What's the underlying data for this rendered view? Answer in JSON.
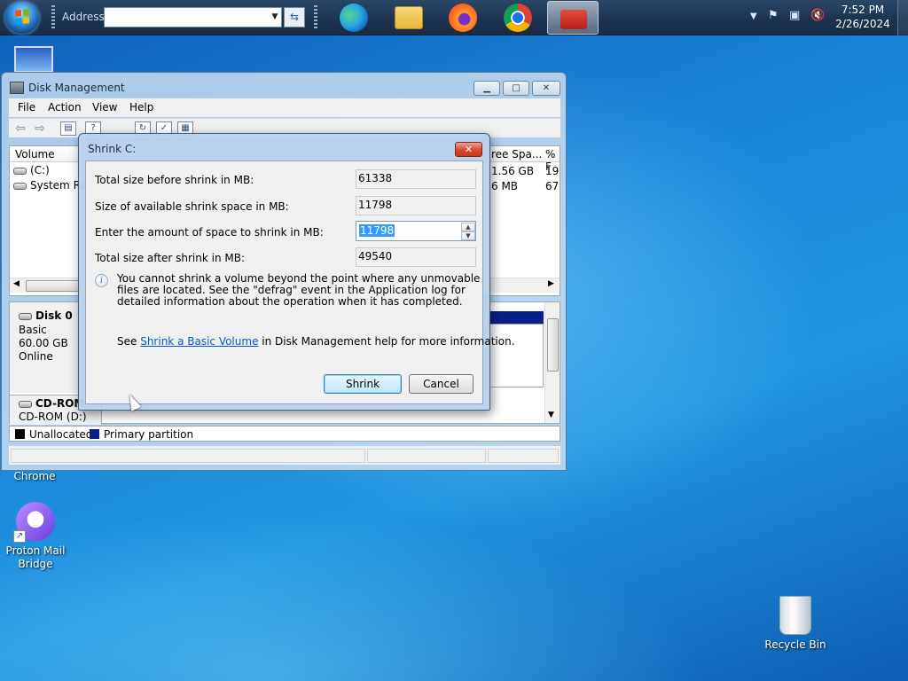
{
  "taskbar": {
    "address_label": "Address",
    "address_value": "",
    "apps": [
      "edge-icon",
      "file-explorer-icon",
      "firefox-icon",
      "chrome-icon",
      "computer-management-icon"
    ],
    "clock": {
      "time": "7:52 PM",
      "date": "2/26/2024"
    }
  },
  "desktop": {
    "icons": {
      "chrome": "Chrome",
      "proton": "Proton Mail Bridge",
      "recycle": "Recycle Bin"
    }
  },
  "disk_management": {
    "title": "Disk Management",
    "menu": [
      "File",
      "Action",
      "View",
      "Help"
    ],
    "columns": {
      "volume": "Volume",
      "free_space": "ree Spa...",
      "pct": "% F"
    },
    "volumes": [
      {
        "name": "(C:)",
        "free": "1.56 GB",
        "pct": "19"
      },
      {
        "name": "System Res",
        "free": "6 MB",
        "pct": "67"
      }
    ],
    "disk0": {
      "name": "Disk 0",
      "type": "Basic",
      "size": "60.00 GB",
      "status": "Online"
    },
    "cdrom": {
      "name": "CD-ROM",
      "drive": "CD-ROM (D:)"
    },
    "legend": [
      {
        "label": "Unallocated",
        "color": "#000000"
      },
      {
        "label": "Primary partition",
        "color": "#0b1f8a"
      }
    ]
  },
  "shrink_dialog": {
    "title": "Shrink C:",
    "close": "✕",
    "total_before_label": "Total size before shrink in MB:",
    "total_before_value": "61338",
    "available_label": "Size of available shrink space in MB:",
    "available_value": "11798",
    "amount_label": "Enter the amount of space to shrink in MB:",
    "amount_value": "11798",
    "total_after_label": "Total size after shrink in MB:",
    "total_after_value": "49540",
    "info": "You cannot shrink a volume beyond the point where any unmovable files are located. See the \"defrag\" event in the Application log for detailed information about the operation when it has completed.",
    "help_prefix": "See ",
    "help_link": "Shrink a Basic Volume",
    "help_suffix": " in Disk Management help for more information.",
    "shrink_button": "Shrink",
    "cancel_button": "Cancel"
  }
}
